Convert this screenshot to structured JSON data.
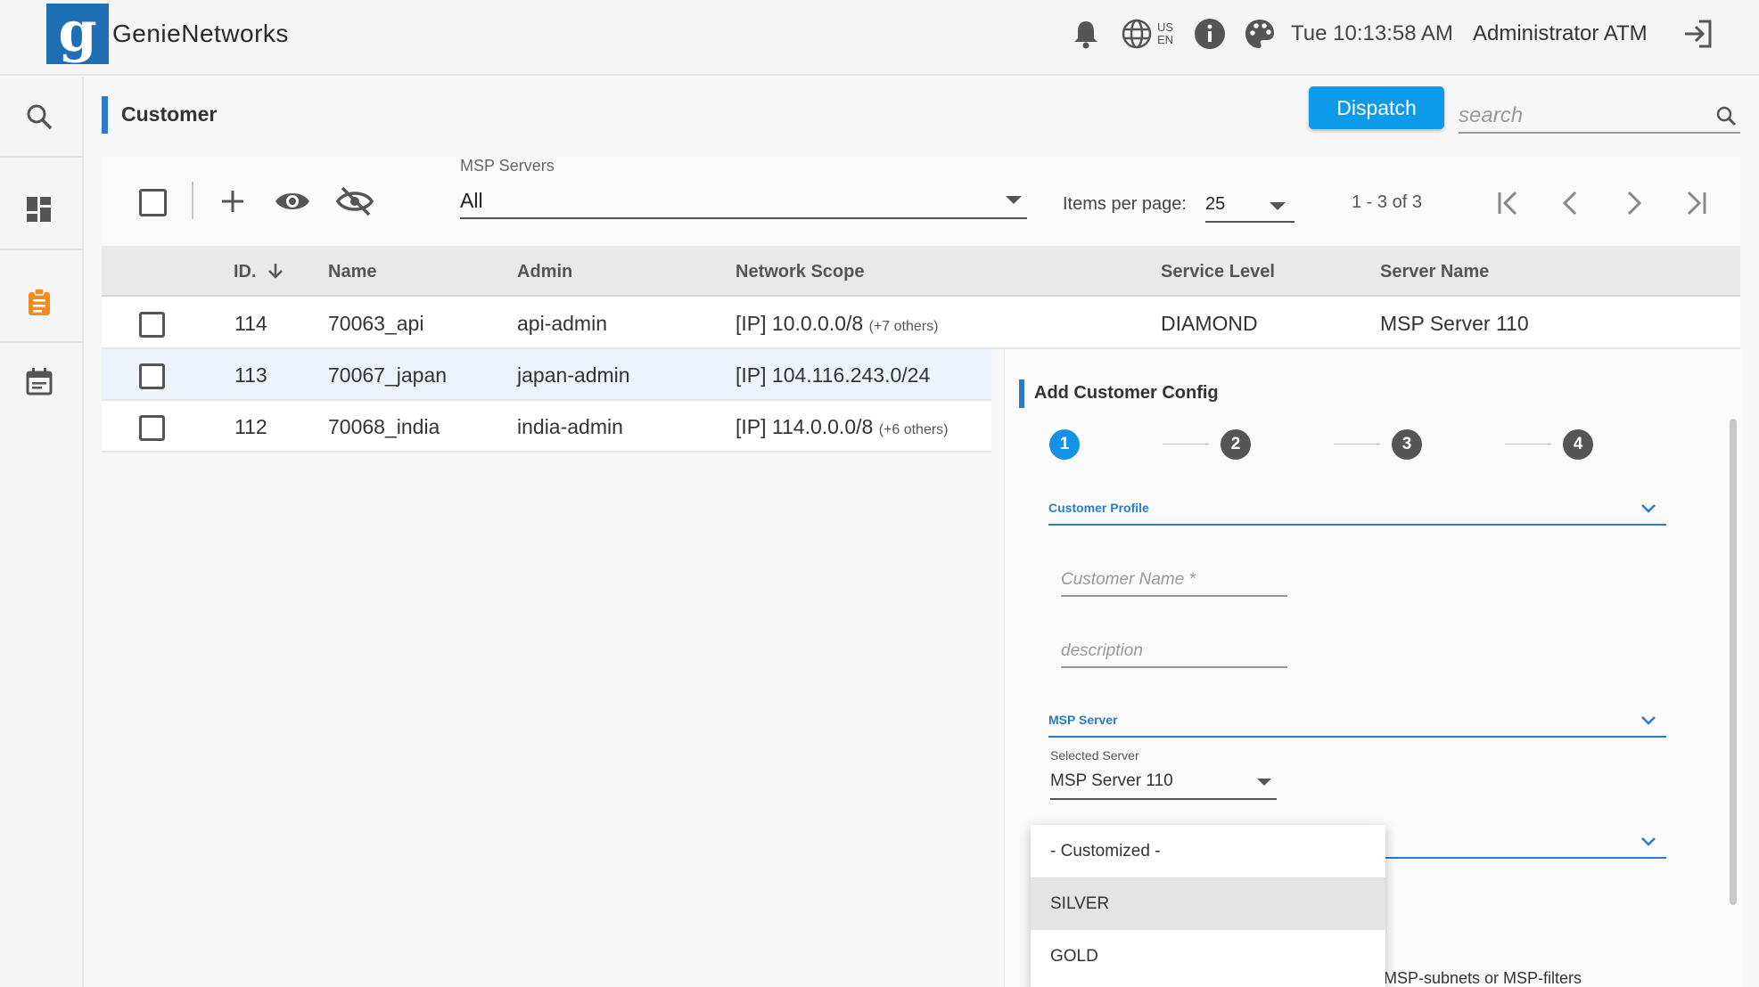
{
  "header": {
    "brand": "GenieNetworks",
    "lang_region": "US",
    "lang_code": "EN",
    "clock": "Tue 10:13:58 AM",
    "user": "Administrator ATM"
  },
  "page": {
    "title": "Customer",
    "dispatch_label": "Dispatch",
    "search_placeholder": "search"
  },
  "toolbar": {
    "msp_label": "MSP Servers",
    "msp_value": "All",
    "ipp_label": "Items per page:",
    "ipp_value": "25",
    "range": "1 - 3 of 3"
  },
  "table": {
    "columns": [
      "ID.",
      "Name",
      "Admin",
      "Network Scope",
      "Service Level",
      "Server Name"
    ],
    "rows": [
      {
        "id": "114",
        "name": "70063_api",
        "admin": "api-admin",
        "scope": "[IP] 10.0.0.0/8",
        "scope_extra": "(+7 others)",
        "level": "DIAMOND",
        "server": "MSP Server 110"
      },
      {
        "id": "113",
        "name": "70067_japan",
        "admin": "japan-admin",
        "scope": "[IP] 104.116.243.0/24",
        "scope_extra": "",
        "level": "",
        "server": ""
      },
      {
        "id": "112",
        "name": "70068_india",
        "admin": "india-admin",
        "scope": "[IP] 114.0.0.0/8",
        "scope_extra": "(+6 others)",
        "level": "",
        "server": ""
      }
    ]
  },
  "panel": {
    "title": "Add Customer Config",
    "steps": [
      "1",
      "2",
      "3",
      "4"
    ],
    "profile_section": "Customer Profile",
    "name_placeholder": "Customer Name *",
    "desc_placeholder": "description",
    "server_section": "MSP Server",
    "selected_server_label": "Selected Server",
    "selected_server_value": "MSP Server 110",
    "hint": "MSP-subnets or MSP-filters"
  },
  "dropdown": {
    "options": [
      "- Customized -",
      "SILVER",
      "GOLD"
    ]
  },
  "colors": {
    "accent": "#2b7cc2",
    "dispatch": "#0d9ae8",
    "nav_active": "#f28c1e"
  }
}
